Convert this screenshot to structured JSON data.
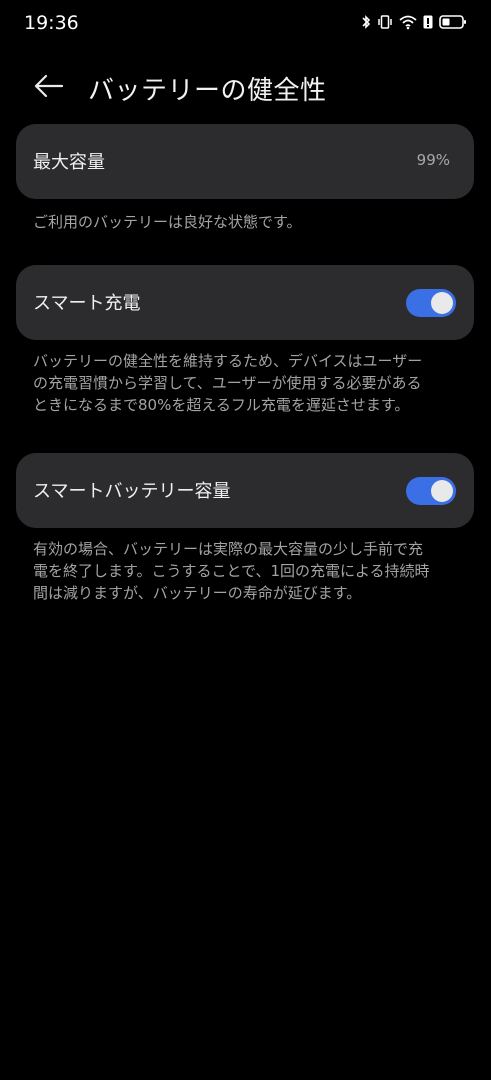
{
  "status_bar": {
    "time": "19:36",
    "icons": [
      "bluetooth-icon",
      "vibrate-icon",
      "wifi-icon",
      "battery-alert-icon",
      "battery-icon"
    ]
  },
  "header": {
    "back_icon": "arrow-left-icon",
    "title": "バッテリーの健全性"
  },
  "max_capacity": {
    "label": "最大容量",
    "value": "99%",
    "description": "ご利用のバッテリーは良好な状態です。"
  },
  "smart_charging": {
    "label": "スマート充電",
    "enabled": true,
    "description_lines": [
      "バッテリーの健全性を維持するため、デバイスはユーザー",
      "の充電習慣から学習して、ユーザーが使用する必要がある",
      "ときになるまで80%を超えるフル充電を遅延させます。"
    ]
  },
  "smart_battery_capacity": {
    "label": "スマートバッテリー容量",
    "enabled": true,
    "description_lines": [
      "有効の場合、バッテリーは実際の最大容量の少し手前で充",
      "電を終了します。こうすることで、1回の充電による持続時",
      "間は減りますが、バッテリーの寿命が延びます。"
    ]
  },
  "colors": {
    "background": "#000000",
    "card": "#2c2c2e",
    "accent": "#3a6fe6",
    "secondary_text": "#a3a3a3"
  }
}
